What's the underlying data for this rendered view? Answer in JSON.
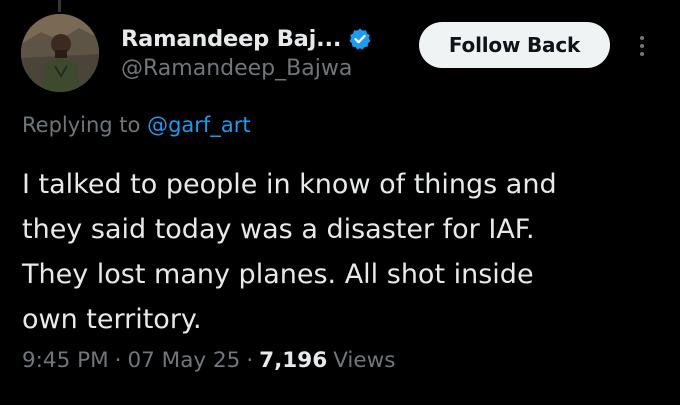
{
  "author": {
    "display_name": "Ramandeep Baj...",
    "handle": "@Ramandeep_Bajwa",
    "verified": true,
    "verified_color": "#1d9bf0"
  },
  "actions": {
    "follow_label": "Follow Back",
    "more_icon": "more-vertical-icon"
  },
  "reply": {
    "prefix": "Replying to",
    "mention": "@garf_art"
  },
  "tweet": {
    "lines": [
      "I talked to people in know of things and",
      "they said today was a disaster for IAF.",
      "They lost many planes. All shot inside",
      "own territory."
    ]
  },
  "meta": {
    "time": "9:45 PM",
    "separator": "·",
    "date": "07 May 25",
    "views_count": "7,196",
    "views_label": "Views"
  },
  "colors": {
    "background": "#000000",
    "text_primary": "#e7e9ea",
    "text_secondary": "#71767b",
    "accent": "#1d9bf0",
    "button_bg": "#eff3f4"
  }
}
